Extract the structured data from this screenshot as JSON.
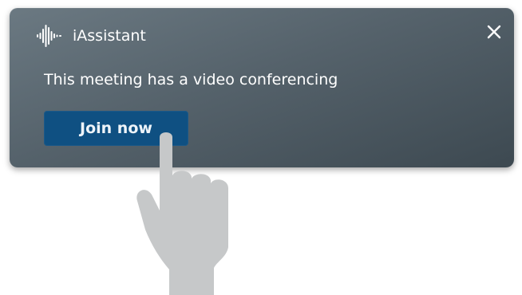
{
  "notification": {
    "app_name": "iAssistant",
    "app_icon": "soundwave-icon",
    "message": "This meeting has a video conferencing",
    "close_label": "X",
    "close_icon": "close-icon",
    "action_label": "Join now"
  },
  "overlay": {
    "pointer_icon": "pointing-hand-icon"
  },
  "colors": {
    "panel_gradient_start": "#6b7982",
    "panel_gradient_end": "#3d4951",
    "button_background": "#0f5082",
    "text": "#ffffff",
    "hand": "#c6c8c9"
  }
}
